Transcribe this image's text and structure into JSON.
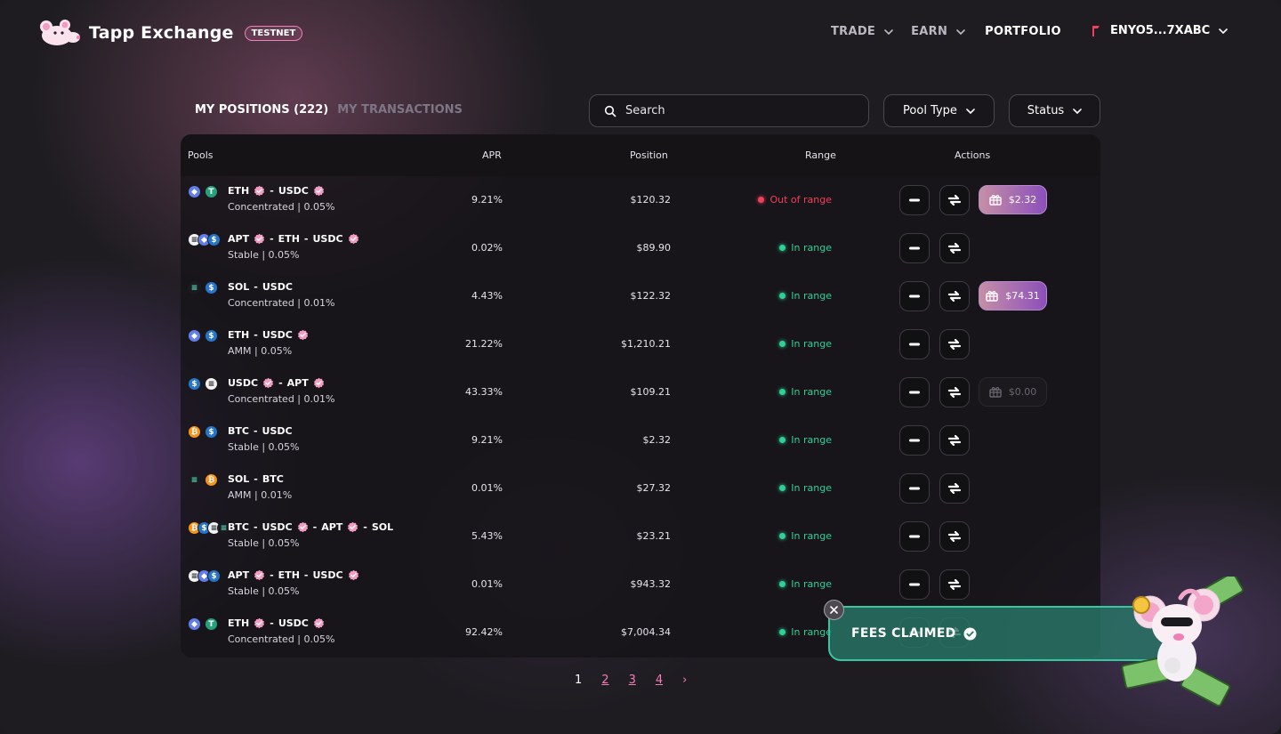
{
  "header": {
    "brand": "Tapp Exchange",
    "badge": "TESTNET",
    "nav": [
      {
        "label": "TRADE"
      },
      {
        "label": "EARN"
      },
      {
        "label": "PORTFOLIO"
      }
    ],
    "wallet": "ENYO5...7XABC"
  },
  "tabs": {
    "positions": "MY POSITIONS (222)",
    "transactions": "MY TRANSACTIONS"
  },
  "search": {
    "placeholder": "Search"
  },
  "filters": {
    "pool_type": "Pool Type",
    "status": "Status"
  },
  "table": {
    "headers": {
      "pools": "Pools",
      "apr": "APR",
      "position": "Position",
      "range": "Range",
      "actions": "Actions"
    },
    "rows": [
      {
        "tokens": [
          "ETH",
          "USDC"
        ],
        "verified": [
          true,
          true
        ],
        "detail": "Concentrated | 0.05%",
        "apr": "9.21%",
        "position": "$120.32",
        "range": "Out of range",
        "in_range": false,
        "claim": "$2.32",
        "claimable": true
      },
      {
        "tokens": [
          "APT",
          "ETH",
          "USDC"
        ],
        "verified": [
          true,
          false,
          true
        ],
        "detail": "Stable | 0.05%",
        "apr": "0.02%",
        "position": "$89.90",
        "range": "In range",
        "in_range": true,
        "claim": null
      },
      {
        "tokens": [
          "SOL",
          "USDC"
        ],
        "verified": [
          false,
          false
        ],
        "detail": "Concentrated | 0.01%",
        "apr": "4.43%",
        "position": "$122.32",
        "range": "In range",
        "in_range": true,
        "claim": "$74.31",
        "claimable": true
      },
      {
        "tokens": [
          "ETH",
          "USDC"
        ],
        "verified": [
          false,
          true
        ],
        "detail": "AMM | 0.05%",
        "apr": "21.22%",
        "position": "$1,210.21",
        "range": "In range",
        "in_range": true,
        "claim": null
      },
      {
        "tokens": [
          "USDC",
          "APT"
        ],
        "verified": [
          true,
          true
        ],
        "detail": "Concentrated | 0.01%",
        "apr": "43.33%",
        "position": "$109.21",
        "range": "In range",
        "in_range": true,
        "claim": "$0.00",
        "claimable": false
      },
      {
        "tokens": [
          "BTC",
          "USDC"
        ],
        "verified": [
          false,
          false
        ],
        "detail": "Stable | 0.05%",
        "apr": "9.21%",
        "position": "$2.32",
        "range": "In range",
        "in_range": true,
        "claim": null
      },
      {
        "tokens": [
          "SOL",
          "BTC"
        ],
        "verified": [
          false,
          false
        ],
        "detail": "AMM | 0.01%",
        "apr": "0.01%",
        "position": "$27.32",
        "range": "In range",
        "in_range": true,
        "claim": null
      },
      {
        "tokens": [
          "BTC",
          "USDC",
          "APT",
          "SOL"
        ],
        "verified": [
          false,
          true,
          true,
          false
        ],
        "detail": "Stable | 0.05%",
        "apr": "5.43%",
        "position": "$23.21",
        "range": "In range",
        "in_range": true,
        "claim": null
      },
      {
        "tokens": [
          "APT",
          "ETH",
          "USDC"
        ],
        "verified": [
          true,
          false,
          true
        ],
        "detail": "Stable | 0.05%",
        "apr": "0.01%",
        "position": "$943.32",
        "range": "In range",
        "in_range": true,
        "claim": null
      },
      {
        "tokens": [
          "ETH",
          "USDC"
        ],
        "verified": [
          true,
          true
        ],
        "detail": "Concentrated | 0.05%",
        "apr": "92.42%",
        "position": "$7,004.34",
        "range": "In range",
        "in_range": true,
        "claim": null
      }
    ]
  },
  "pagination": {
    "pages": [
      "1",
      "2",
      "3",
      "4"
    ],
    "current": "1",
    "next": "›"
  },
  "toast": {
    "message": "FEES CLAIMED"
  },
  "colors": {
    "accent_pink": "#f07fb8",
    "in_range": "#2fcf95",
    "out_of_range": "#f0405c",
    "toast_bg": "#287668",
    "claim_gradient_start": "#c58fa6",
    "claim_gradient_end": "#8c4fba"
  },
  "token_colors": {
    "ETH": "#627eea",
    "USDC": "#2775ca",
    "APT": "#f2f2f2",
    "SOL": "#1b1b1f",
    "BTC": "#f7931a",
    "USDT": "#26a17b"
  }
}
